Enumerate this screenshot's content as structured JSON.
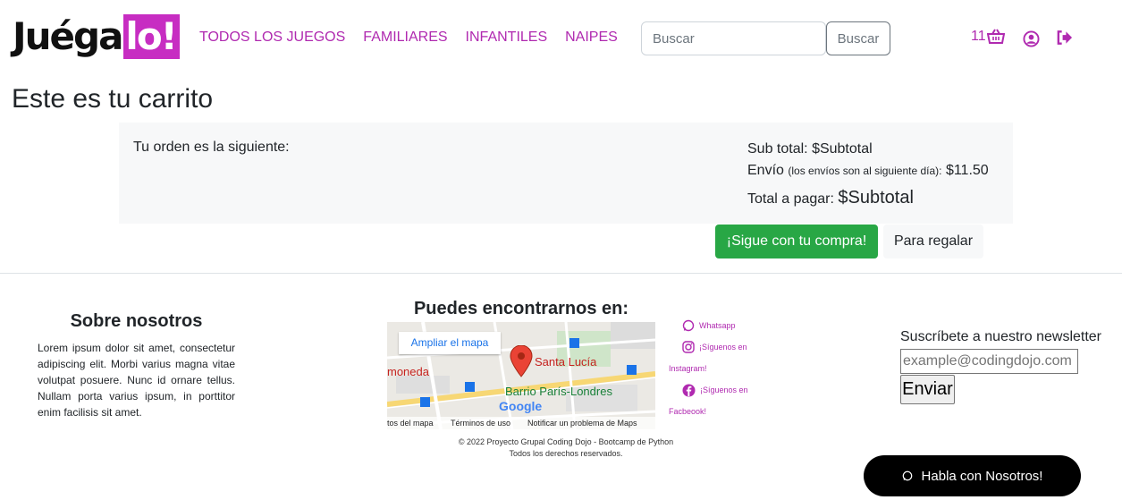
{
  "header": {
    "logo_main": "Juéga",
    "logo_box": "lo!",
    "nav": [
      "TODOS LOS JUEGOS",
      "FAMILIARES",
      "INFANTILES",
      "NAIPES"
    ],
    "search_placeholder": "Buscar",
    "search_button": "Buscar",
    "cart_count": "11",
    "accent_color": "#b02ab0"
  },
  "page": {
    "title": "Este es tu carrito",
    "order_label": "Tu orden es la siguiente:",
    "subtotal_label": "Sub total:",
    "subtotal_value": "$Subtotal",
    "shipping_label": "Envío",
    "shipping_note": "(los envíos son al siguiente día):",
    "shipping_value": "$11.50",
    "total_label": "Total a pagar:",
    "total_value": "$Subtotal",
    "continue_button": "¡Sigue con tu compra!",
    "gift_button": "Para regalar"
  },
  "footer": {
    "about_title": "Sobre nosotros",
    "about_text": "Lorem ipsum dolor sit amet, consectetur adipiscing elit. Morbi varius magna vitae volutpat posuere. Nunc id ornare tellus. Nullam porta varius ipsum, in porttitor enim facilisis sit amet.",
    "map_title": "Puedes encontrarnos en:",
    "map": {
      "enlarge_link": "Ampliar el mapa",
      "label_santa_lucia": "Santa Lucía",
      "label_barrio": "Barrio París-Londres",
      "label_moneda": "moneda",
      "label_google": "Google",
      "bar_data": "tos del mapa",
      "bar_terms": "Términos de uso",
      "bar_report": "Notificar un problema de Maps"
    },
    "copyright_line1": "© 2022 Proyecto Grupal Coding Dojo - Bootcamp de Python",
    "copyright_line2": "Todos los derechos reservados.",
    "social": {
      "whatsapp": "Whatsapp",
      "instagram_a": "¡Síguenos en",
      "instagram_b": "Instagram!",
      "facebook_a": "¡Síguenos en",
      "facebook_b": "Facbeook!"
    },
    "newsletter_label": "Suscríbete a nuestro newsletter",
    "newsletter_placeholder": "example@codingdojo.com",
    "newsletter_button": "Enviar",
    "chat_button": "Habla con Nosotros!"
  }
}
